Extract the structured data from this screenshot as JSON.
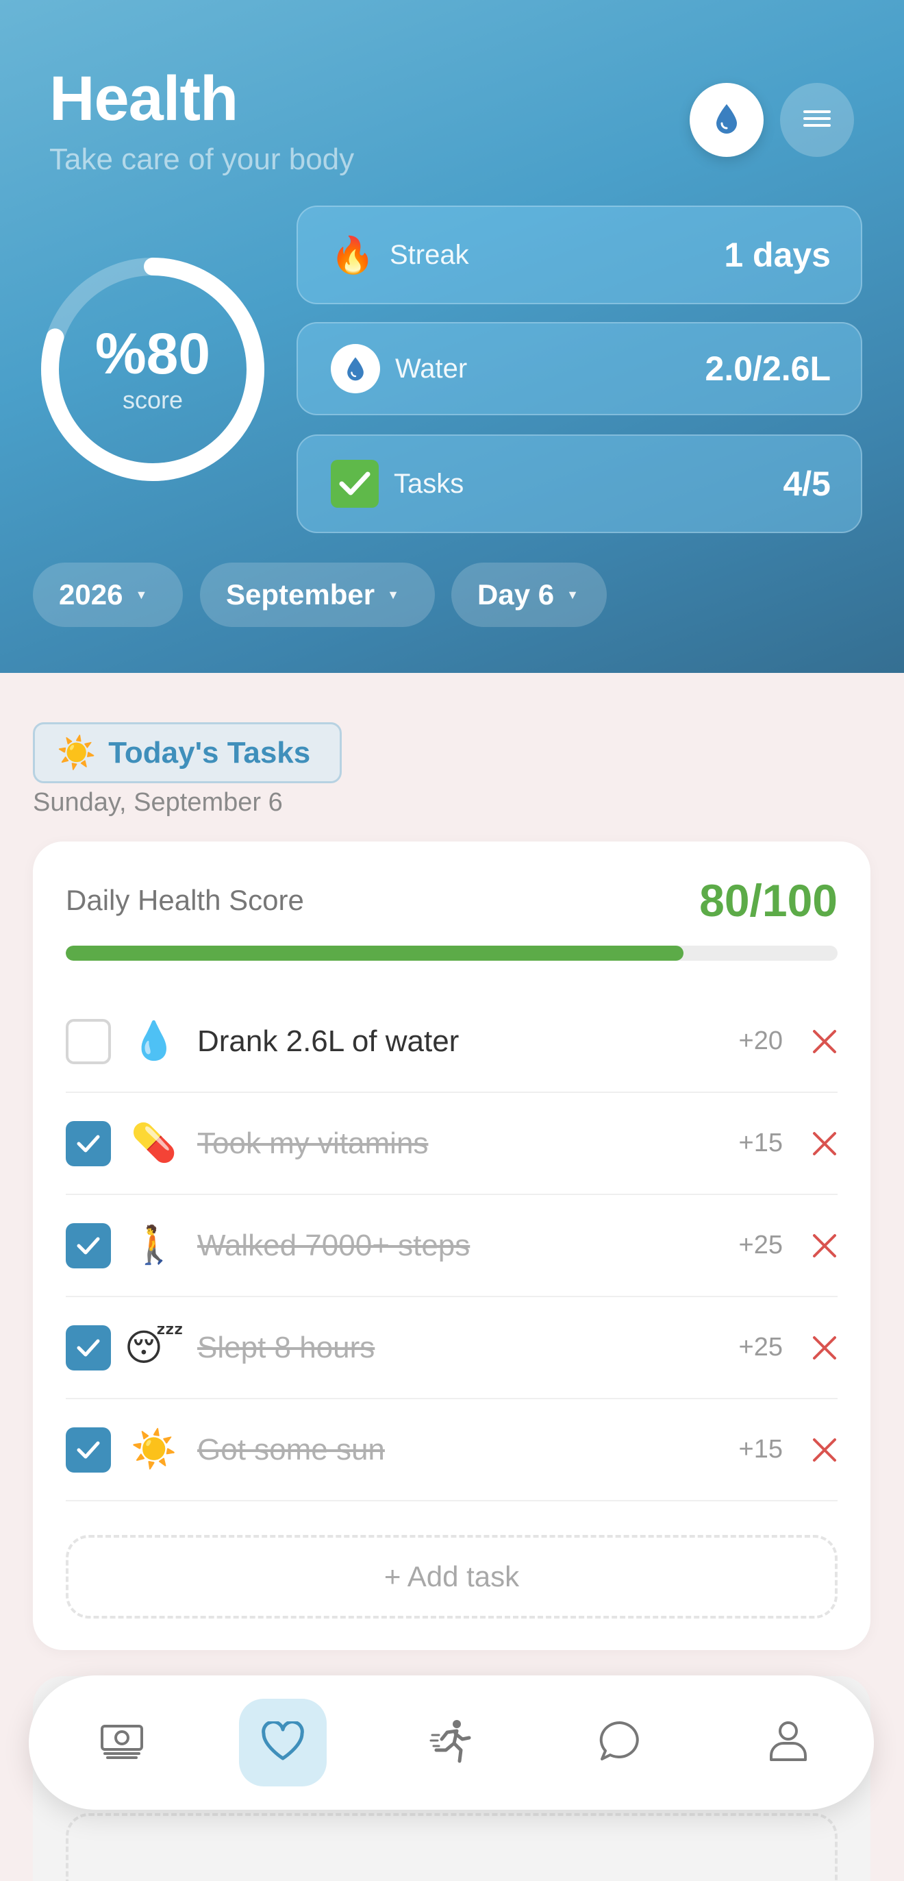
{
  "header": {
    "title": "Health",
    "subtitle": "Take care of your body",
    "water_button_icon": "water-drop-icon",
    "menu_button_icon": "hamburger-menu-icon"
  },
  "score": {
    "value_label": "%80",
    "label": "score",
    "fraction": 0.8
  },
  "stats": [
    {
      "icon": "fire-icon",
      "label": "Streak",
      "value": "1 days"
    },
    {
      "icon": "water-drop-icon",
      "label": "Water",
      "value": "2.0/2.6L"
    },
    {
      "icon": "checkmark-icon",
      "label": "Tasks",
      "value": "4/5"
    }
  ],
  "filters": {
    "year": "2026",
    "month": "September",
    "day": "Day 6"
  },
  "today": {
    "badge": "Today's Tasks",
    "date": "Sunday, September 6"
  },
  "daily_score": {
    "label": "Daily Health Score",
    "value": "80/100",
    "progress": 0.8
  },
  "tasks": [
    {
      "emoji": "💧",
      "text": "Drank 2.6L of water",
      "points": "+20",
      "done": false
    },
    {
      "emoji": "💊",
      "text": "Took my vitamins",
      "points": "+15",
      "done": true
    },
    {
      "emoji": "🚶",
      "text": "Walked 7000+ steps",
      "points": "+25",
      "done": true
    },
    {
      "emoji": "😴",
      "text": "Slept 8 hours",
      "points": "+25",
      "done": true
    },
    {
      "emoji": "☀️",
      "text": "Got some sun",
      "points": "+15",
      "done": true
    }
  ],
  "add_task_label": "+ Add task",
  "nav": [
    {
      "icon": "money-icon",
      "active": false
    },
    {
      "icon": "heart-icon",
      "active": true
    },
    {
      "icon": "running-icon",
      "active": false
    },
    {
      "icon": "chat-bubble-icon",
      "active": false
    },
    {
      "icon": "profile-icon",
      "active": false
    }
  ],
  "colors": {
    "accent": "#3f8fbb",
    "score_green": "#5cab48",
    "delete_red": "#d9534f"
  }
}
